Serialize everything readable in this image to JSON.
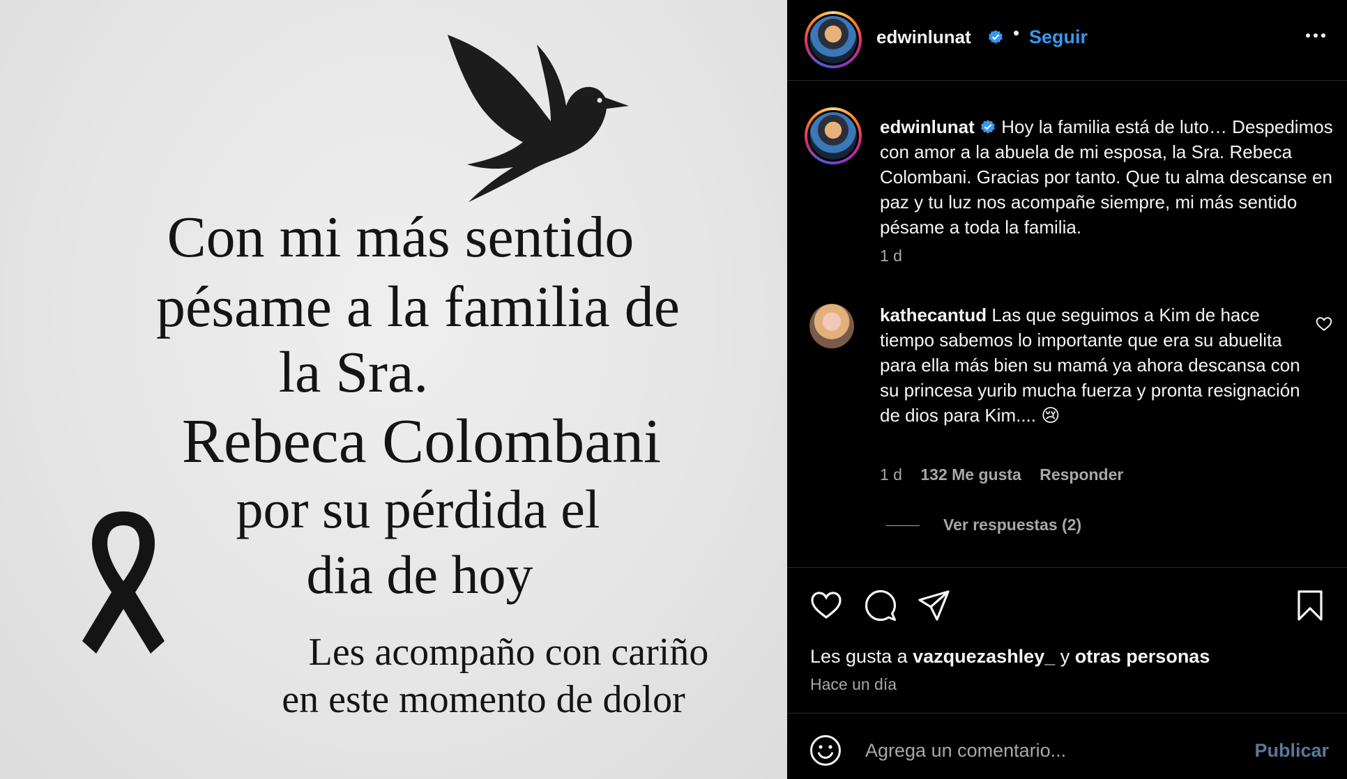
{
  "post_image": {
    "lines": [
      "Con mi más sentido",
      "pésame a la familia de",
      "la Sra.",
      "Rebeca Colombani",
      "por su pérdida el",
      "dia de hoy",
      "Les acompaño con cariño",
      "en este momento de dolor"
    ],
    "dove_icon": "dove-icon",
    "ribbon_icon": "mourning-ribbon-icon",
    "text_color": "#141414",
    "background_color": "#e6e6e6"
  },
  "header": {
    "username": "edwinlunat",
    "separator": "•",
    "follow_label": "Seguir",
    "more_icon": "more-options-icon"
  },
  "caption": {
    "username": "edwinlunat",
    "text": "Hoy la familia está de luto… Despedimos con amor a la abuela de mi esposa, la Sra. Rebeca Colombani. Gracias por tanto. Que tu alma descanse en paz y tu luz nos acompañe siempre, mi más sentido pésame a toda la familia.",
    "time": "1 d"
  },
  "comments": [
    {
      "username": "kathecantud",
      "text": "Las que seguimos a Kim de hace tiempo sabemos lo importante que era su abuelita para ella más bien su mamá ya ahora descansa con su princesa yurib mucha fuerza y pronta resignación de dios para Kim.... 😢",
      "time": "1 d",
      "likes": "132 Me gusta",
      "reply_label": "Responder",
      "view_replies": "Ver respuestas (2)"
    }
  ],
  "actions": {
    "liked_by_prefix": "Les gusta a",
    "liked_by_user": "vazquezashley_",
    "liked_by_join": "y",
    "liked_by_others": "otras personas",
    "time_ago": "Hace un día"
  },
  "composer": {
    "placeholder": "Agrega un comentario...",
    "publish_label": "Publicar"
  },
  "colors": {
    "accent": "#3897f0",
    "background": "#000000",
    "secondary_text": "#a8a8a8",
    "divider": "#262626"
  }
}
